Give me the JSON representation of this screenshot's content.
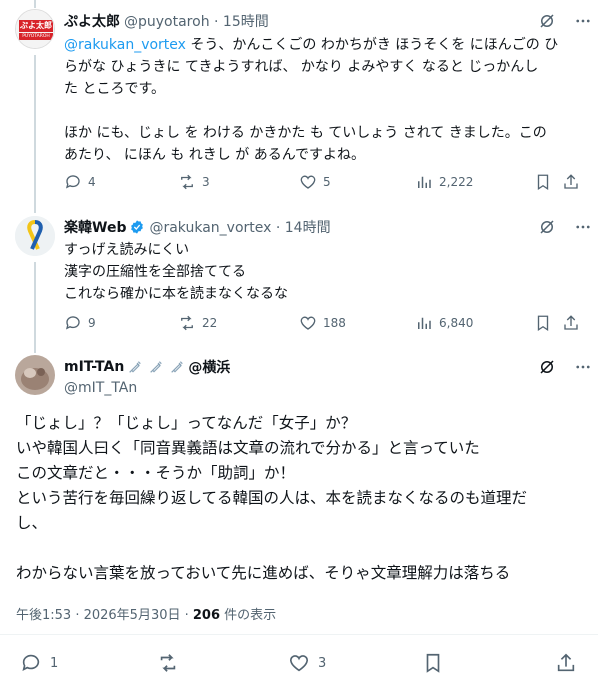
{
  "tweet1": {
    "avatar_text_top": "ぷよ太郎",
    "avatar_text_bottom": "PUYOTAROH",
    "name": "ぷよ太郎",
    "handle_time": "@puyotaroh · 15時間",
    "mention": "@rakukan_vortex",
    "lines": [
      " そう、かんこくごの わかちがき ほうそくを にほんごの ひ",
      "らがな ひょうきに てきようすれば、 かなり よみやすく なると じっかんし",
      "た ところです。",
      "",
      "ほか にも、じょし を わける かきかた も ていしょう されて きました。この",
      "あたり、 にほん も れきし が あるんですよね。"
    ],
    "replies": "4",
    "reposts": "3",
    "likes": "5",
    "views": "2,222"
  },
  "tweet2": {
    "name": "楽韓Web",
    "handle_time": "@rakukan_vortex · 14時間",
    "lines": [
      "すっげえ読みにくい",
      "漢字の圧縮性を全部捨ててる",
      "これなら確かに本を読まなくなるな"
    ],
    "replies": "9",
    "reposts": "22",
    "likes": "188",
    "views": "6,840"
  },
  "main": {
    "name": "mIT-TAn",
    "name_suffix": "@横浜",
    "handle": "@mIT_TAn",
    "lines": [
      "「じょし」？「じょし」ってなんだ「女子」か？",
      "いや韓国人曰く「同音異義語は文章の流れで分かる」と言っていた",
      "この文章だと・・・そうか「助詞」か！",
      "という苦行を毎回繰り返してる韓国の人は、本を読まなくなるのも道理だ",
      "し、",
      "",
      "わからない言葉を放っておいて先に進めば、そりゃ文章理解力は落ちる"
    ],
    "timestamp": "午後1:53 · 2026年5月30日 · ",
    "views_count": "206",
    "views_label": " 件の表示",
    "replies": "1",
    "likes": "3"
  },
  "colors": {
    "accent": "#1d9bf0",
    "secondary_text": "#536471",
    "verified": "#1d9bf0"
  }
}
